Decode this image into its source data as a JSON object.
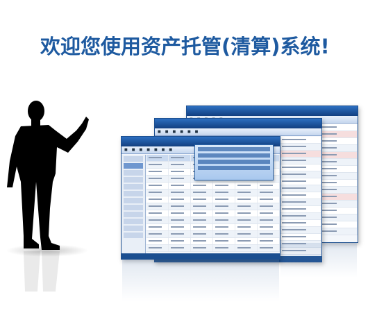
{
  "banner": {
    "title": "欢迎您使用资产托管(清算)系统!"
  },
  "illustration": {
    "presenter": "businessman-silhouette-pointing",
    "screens": "stacked-application-screenshots"
  },
  "colors": {
    "title": "#1e5aa0",
    "window_frame": "#1d4f8f",
    "silhouette": "#000000"
  }
}
